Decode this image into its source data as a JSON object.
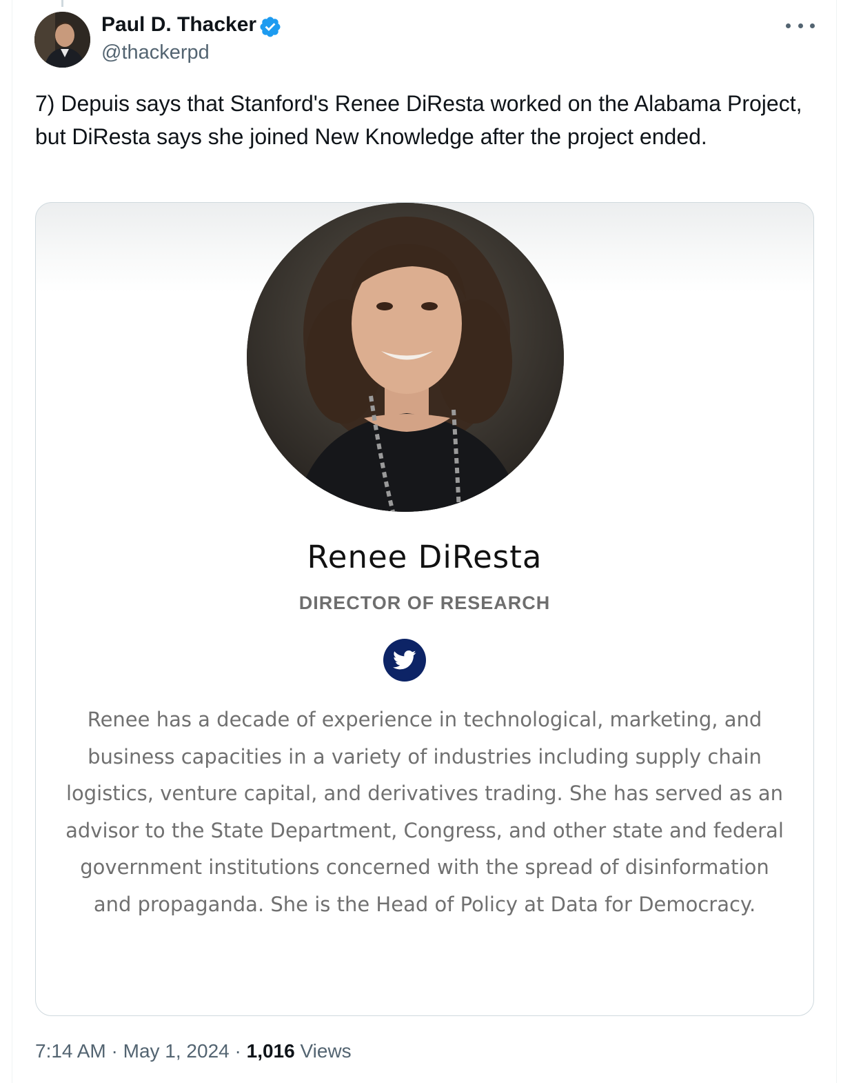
{
  "tweet": {
    "author": {
      "name": "Paul D. Thacker",
      "handle": "@thackerpd",
      "verified": true,
      "verified_color": "#1d9bf0",
      "avatar_icon": "author-avatar"
    },
    "text": "7) Depuis says that Stanford's Renee DiResta worked on the Alabama Project, but DiResta says she joined New Knowledge after the project ended.",
    "more_icon": "more-horizontal-icon",
    "media": {
      "portrait_icon": "person-portrait",
      "name": "Renee DiResta",
      "title": "DIRECTOR OF RESEARCH",
      "social_icon": "twitter-bird-icon",
      "social_icon_color": "#0d2466",
      "bio": "Renee has a decade of experience in technological, marketing, and business capacities in a variety of industries including supply chain logistics, venture capital, and derivatives trading. She has served as an advisor to the State Department, Congress, and other state and federal government institutions concerned with the spread of disinformation and propaganda. She is the Head of Policy at Data for Democracy."
    },
    "meta": {
      "time": "7:14 AM",
      "separator": "·",
      "date": "May 1, 2024",
      "views_count": "1,016",
      "views_label": "Views"
    }
  }
}
